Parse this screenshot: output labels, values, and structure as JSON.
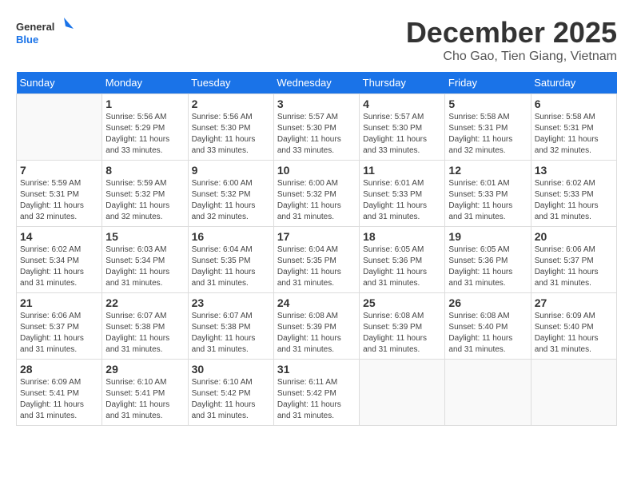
{
  "header": {
    "logo_general": "General",
    "logo_blue": "Blue",
    "title": "December 2025",
    "subtitle": "Cho Gao, Tien Giang, Vietnam"
  },
  "weekdays": [
    "Sunday",
    "Monday",
    "Tuesday",
    "Wednesday",
    "Thursday",
    "Friday",
    "Saturday"
  ],
  "weeks": [
    [
      {
        "day": "",
        "sunrise": "",
        "sunset": "",
        "daylight": ""
      },
      {
        "day": "1",
        "sunrise": "Sunrise: 5:56 AM",
        "sunset": "Sunset: 5:29 PM",
        "daylight": "Daylight: 11 hours and 33 minutes."
      },
      {
        "day": "2",
        "sunrise": "Sunrise: 5:56 AM",
        "sunset": "Sunset: 5:30 PM",
        "daylight": "Daylight: 11 hours and 33 minutes."
      },
      {
        "day": "3",
        "sunrise": "Sunrise: 5:57 AM",
        "sunset": "Sunset: 5:30 PM",
        "daylight": "Daylight: 11 hours and 33 minutes."
      },
      {
        "day": "4",
        "sunrise": "Sunrise: 5:57 AM",
        "sunset": "Sunset: 5:30 PM",
        "daylight": "Daylight: 11 hours and 33 minutes."
      },
      {
        "day": "5",
        "sunrise": "Sunrise: 5:58 AM",
        "sunset": "Sunset: 5:31 PM",
        "daylight": "Daylight: 11 hours and 32 minutes."
      },
      {
        "day": "6",
        "sunrise": "Sunrise: 5:58 AM",
        "sunset": "Sunset: 5:31 PM",
        "daylight": "Daylight: 11 hours and 32 minutes."
      }
    ],
    [
      {
        "day": "7",
        "sunrise": "Sunrise: 5:59 AM",
        "sunset": "Sunset: 5:31 PM",
        "daylight": "Daylight: 11 hours and 32 minutes."
      },
      {
        "day": "8",
        "sunrise": "Sunrise: 5:59 AM",
        "sunset": "Sunset: 5:32 PM",
        "daylight": "Daylight: 11 hours and 32 minutes."
      },
      {
        "day": "9",
        "sunrise": "Sunrise: 6:00 AM",
        "sunset": "Sunset: 5:32 PM",
        "daylight": "Daylight: 11 hours and 32 minutes."
      },
      {
        "day": "10",
        "sunrise": "Sunrise: 6:00 AM",
        "sunset": "Sunset: 5:32 PM",
        "daylight": "Daylight: 11 hours and 31 minutes."
      },
      {
        "day": "11",
        "sunrise": "Sunrise: 6:01 AM",
        "sunset": "Sunset: 5:33 PM",
        "daylight": "Daylight: 11 hours and 31 minutes."
      },
      {
        "day": "12",
        "sunrise": "Sunrise: 6:01 AM",
        "sunset": "Sunset: 5:33 PM",
        "daylight": "Daylight: 11 hours and 31 minutes."
      },
      {
        "day": "13",
        "sunrise": "Sunrise: 6:02 AM",
        "sunset": "Sunset: 5:33 PM",
        "daylight": "Daylight: 11 hours and 31 minutes."
      }
    ],
    [
      {
        "day": "14",
        "sunrise": "Sunrise: 6:02 AM",
        "sunset": "Sunset: 5:34 PM",
        "daylight": "Daylight: 11 hours and 31 minutes."
      },
      {
        "day": "15",
        "sunrise": "Sunrise: 6:03 AM",
        "sunset": "Sunset: 5:34 PM",
        "daylight": "Daylight: 11 hours and 31 minutes."
      },
      {
        "day": "16",
        "sunrise": "Sunrise: 6:04 AM",
        "sunset": "Sunset: 5:35 PM",
        "daylight": "Daylight: 11 hours and 31 minutes."
      },
      {
        "day": "17",
        "sunrise": "Sunrise: 6:04 AM",
        "sunset": "Sunset: 5:35 PM",
        "daylight": "Daylight: 11 hours and 31 minutes."
      },
      {
        "day": "18",
        "sunrise": "Sunrise: 6:05 AM",
        "sunset": "Sunset: 5:36 PM",
        "daylight": "Daylight: 11 hours and 31 minutes."
      },
      {
        "day": "19",
        "sunrise": "Sunrise: 6:05 AM",
        "sunset": "Sunset: 5:36 PM",
        "daylight": "Daylight: 11 hours and 31 minutes."
      },
      {
        "day": "20",
        "sunrise": "Sunrise: 6:06 AM",
        "sunset": "Sunset: 5:37 PM",
        "daylight": "Daylight: 11 hours and 31 minutes."
      }
    ],
    [
      {
        "day": "21",
        "sunrise": "Sunrise: 6:06 AM",
        "sunset": "Sunset: 5:37 PM",
        "daylight": "Daylight: 11 hours and 31 minutes."
      },
      {
        "day": "22",
        "sunrise": "Sunrise: 6:07 AM",
        "sunset": "Sunset: 5:38 PM",
        "daylight": "Daylight: 11 hours and 31 minutes."
      },
      {
        "day": "23",
        "sunrise": "Sunrise: 6:07 AM",
        "sunset": "Sunset: 5:38 PM",
        "daylight": "Daylight: 11 hours and 31 minutes."
      },
      {
        "day": "24",
        "sunrise": "Sunrise: 6:08 AM",
        "sunset": "Sunset: 5:39 PM",
        "daylight": "Daylight: 11 hours and 31 minutes."
      },
      {
        "day": "25",
        "sunrise": "Sunrise: 6:08 AM",
        "sunset": "Sunset: 5:39 PM",
        "daylight": "Daylight: 11 hours and 31 minutes."
      },
      {
        "day": "26",
        "sunrise": "Sunrise: 6:08 AM",
        "sunset": "Sunset: 5:40 PM",
        "daylight": "Daylight: 11 hours and 31 minutes."
      },
      {
        "day": "27",
        "sunrise": "Sunrise: 6:09 AM",
        "sunset": "Sunset: 5:40 PM",
        "daylight": "Daylight: 11 hours and 31 minutes."
      }
    ],
    [
      {
        "day": "28",
        "sunrise": "Sunrise: 6:09 AM",
        "sunset": "Sunset: 5:41 PM",
        "daylight": "Daylight: 11 hours and 31 minutes."
      },
      {
        "day": "29",
        "sunrise": "Sunrise: 6:10 AM",
        "sunset": "Sunset: 5:41 PM",
        "daylight": "Daylight: 11 hours and 31 minutes."
      },
      {
        "day": "30",
        "sunrise": "Sunrise: 6:10 AM",
        "sunset": "Sunset: 5:42 PM",
        "daylight": "Daylight: 11 hours and 31 minutes."
      },
      {
        "day": "31",
        "sunrise": "Sunrise: 6:11 AM",
        "sunset": "Sunset: 5:42 PM",
        "daylight": "Daylight: 11 hours and 31 minutes."
      },
      {
        "day": "",
        "sunrise": "",
        "sunset": "",
        "daylight": ""
      },
      {
        "day": "",
        "sunrise": "",
        "sunset": "",
        "daylight": ""
      },
      {
        "day": "",
        "sunrise": "",
        "sunset": "",
        "daylight": ""
      }
    ]
  ]
}
